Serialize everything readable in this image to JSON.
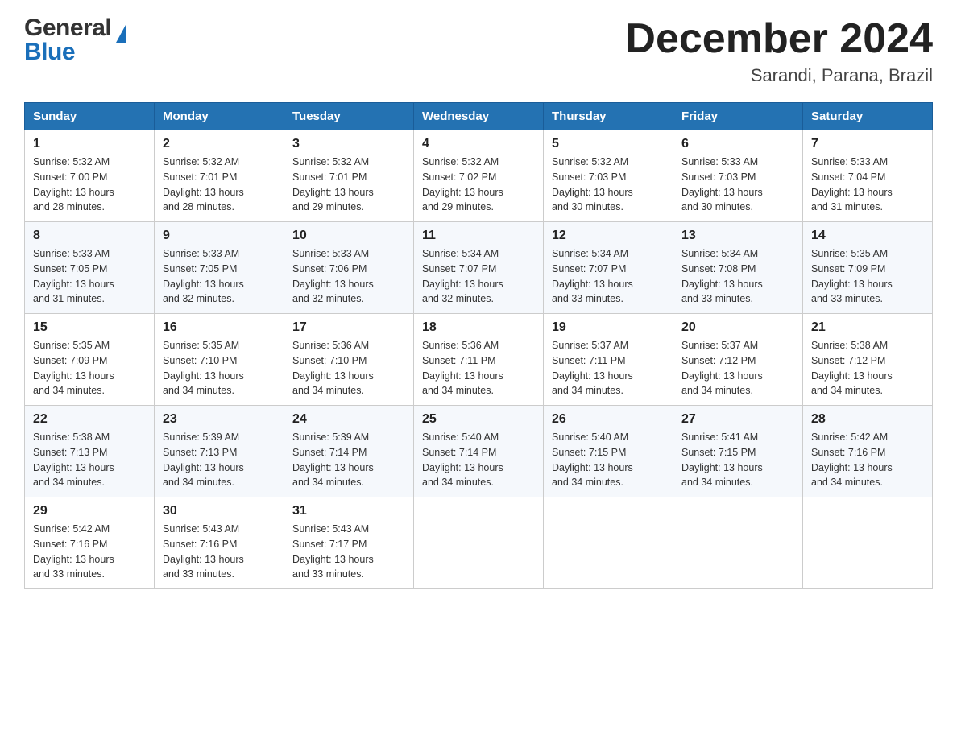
{
  "header": {
    "logo_line1": "General",
    "logo_line2": "Blue",
    "month_title": "December 2024",
    "subtitle": "Sarandi, Parana, Brazil"
  },
  "days_of_week": [
    "Sunday",
    "Monday",
    "Tuesday",
    "Wednesday",
    "Thursday",
    "Friday",
    "Saturday"
  ],
  "weeks": [
    [
      {
        "day": "1",
        "sunrise": "5:32 AM",
        "sunset": "7:00 PM",
        "daylight": "13 hours and 28 minutes."
      },
      {
        "day": "2",
        "sunrise": "5:32 AM",
        "sunset": "7:01 PM",
        "daylight": "13 hours and 28 minutes."
      },
      {
        "day": "3",
        "sunrise": "5:32 AM",
        "sunset": "7:01 PM",
        "daylight": "13 hours and 29 minutes."
      },
      {
        "day": "4",
        "sunrise": "5:32 AM",
        "sunset": "7:02 PM",
        "daylight": "13 hours and 29 minutes."
      },
      {
        "day": "5",
        "sunrise": "5:32 AM",
        "sunset": "7:03 PM",
        "daylight": "13 hours and 30 minutes."
      },
      {
        "day": "6",
        "sunrise": "5:33 AM",
        "sunset": "7:03 PM",
        "daylight": "13 hours and 30 minutes."
      },
      {
        "day": "7",
        "sunrise": "5:33 AM",
        "sunset": "7:04 PM",
        "daylight": "13 hours and 31 minutes."
      }
    ],
    [
      {
        "day": "8",
        "sunrise": "5:33 AM",
        "sunset": "7:05 PM",
        "daylight": "13 hours and 31 minutes."
      },
      {
        "day": "9",
        "sunrise": "5:33 AM",
        "sunset": "7:05 PM",
        "daylight": "13 hours and 32 minutes."
      },
      {
        "day": "10",
        "sunrise": "5:33 AM",
        "sunset": "7:06 PM",
        "daylight": "13 hours and 32 minutes."
      },
      {
        "day": "11",
        "sunrise": "5:34 AM",
        "sunset": "7:07 PM",
        "daylight": "13 hours and 32 minutes."
      },
      {
        "day": "12",
        "sunrise": "5:34 AM",
        "sunset": "7:07 PM",
        "daylight": "13 hours and 33 minutes."
      },
      {
        "day": "13",
        "sunrise": "5:34 AM",
        "sunset": "7:08 PM",
        "daylight": "13 hours and 33 minutes."
      },
      {
        "day": "14",
        "sunrise": "5:35 AM",
        "sunset": "7:09 PM",
        "daylight": "13 hours and 33 minutes."
      }
    ],
    [
      {
        "day": "15",
        "sunrise": "5:35 AM",
        "sunset": "7:09 PM",
        "daylight": "13 hours and 34 minutes."
      },
      {
        "day": "16",
        "sunrise": "5:35 AM",
        "sunset": "7:10 PM",
        "daylight": "13 hours and 34 minutes."
      },
      {
        "day": "17",
        "sunrise": "5:36 AM",
        "sunset": "7:10 PM",
        "daylight": "13 hours and 34 minutes."
      },
      {
        "day": "18",
        "sunrise": "5:36 AM",
        "sunset": "7:11 PM",
        "daylight": "13 hours and 34 minutes."
      },
      {
        "day": "19",
        "sunrise": "5:37 AM",
        "sunset": "7:11 PM",
        "daylight": "13 hours and 34 minutes."
      },
      {
        "day": "20",
        "sunrise": "5:37 AM",
        "sunset": "7:12 PM",
        "daylight": "13 hours and 34 minutes."
      },
      {
        "day": "21",
        "sunrise": "5:38 AM",
        "sunset": "7:12 PM",
        "daylight": "13 hours and 34 minutes."
      }
    ],
    [
      {
        "day": "22",
        "sunrise": "5:38 AM",
        "sunset": "7:13 PM",
        "daylight": "13 hours and 34 minutes."
      },
      {
        "day": "23",
        "sunrise": "5:39 AM",
        "sunset": "7:13 PM",
        "daylight": "13 hours and 34 minutes."
      },
      {
        "day": "24",
        "sunrise": "5:39 AM",
        "sunset": "7:14 PM",
        "daylight": "13 hours and 34 minutes."
      },
      {
        "day": "25",
        "sunrise": "5:40 AM",
        "sunset": "7:14 PM",
        "daylight": "13 hours and 34 minutes."
      },
      {
        "day": "26",
        "sunrise": "5:40 AM",
        "sunset": "7:15 PM",
        "daylight": "13 hours and 34 minutes."
      },
      {
        "day": "27",
        "sunrise": "5:41 AM",
        "sunset": "7:15 PM",
        "daylight": "13 hours and 34 minutes."
      },
      {
        "day": "28",
        "sunrise": "5:42 AM",
        "sunset": "7:16 PM",
        "daylight": "13 hours and 34 minutes."
      }
    ],
    [
      {
        "day": "29",
        "sunrise": "5:42 AM",
        "sunset": "7:16 PM",
        "daylight": "13 hours and 33 minutes."
      },
      {
        "day": "30",
        "sunrise": "5:43 AM",
        "sunset": "7:16 PM",
        "daylight": "13 hours and 33 minutes."
      },
      {
        "day": "31",
        "sunrise": "5:43 AM",
        "sunset": "7:17 PM",
        "daylight": "13 hours and 33 minutes."
      },
      {
        "day": "",
        "sunrise": "",
        "sunset": "",
        "daylight": ""
      },
      {
        "day": "",
        "sunrise": "",
        "sunset": "",
        "daylight": ""
      },
      {
        "day": "",
        "sunrise": "",
        "sunset": "",
        "daylight": ""
      },
      {
        "day": "",
        "sunrise": "",
        "sunset": "",
        "daylight": ""
      }
    ]
  ],
  "labels": {
    "sunrise": "Sunrise:",
    "sunset": "Sunset:",
    "daylight": "Daylight:"
  }
}
